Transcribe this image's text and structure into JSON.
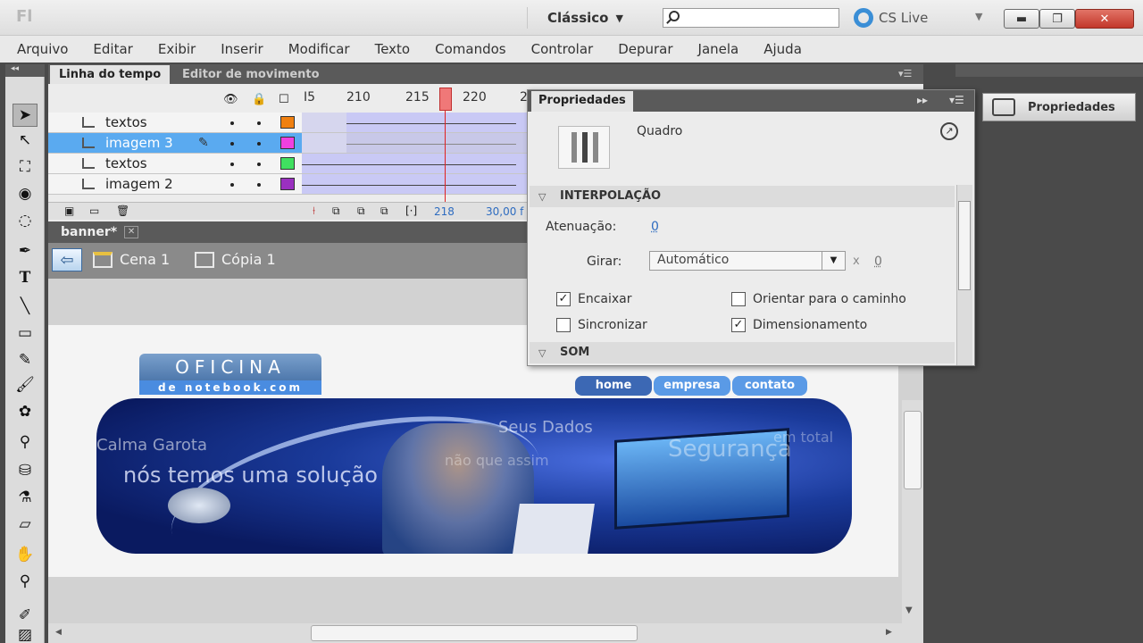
{
  "app": {
    "logo": "Fl"
  },
  "titlebar": {
    "workspace": "Clássico",
    "search_placeholder": "",
    "cslive": "CS Live"
  },
  "menu": [
    "Arquivo",
    "Editar",
    "Exibir",
    "Inserir",
    "Modificar",
    "Texto",
    "Comandos",
    "Controlar",
    "Depurar",
    "Janela",
    "Ajuda"
  ],
  "timeline": {
    "tabs": [
      "Linha do tempo",
      "Editor de movimento"
    ],
    "ruler": [
      "I5",
      "210",
      "215",
      "220",
      "2"
    ],
    "layers": [
      {
        "name": "textos",
        "color": "#f08010"
      },
      {
        "name": "imagem 3",
        "color": "#f040e0"
      },
      {
        "name": "textos",
        "color": "#40e060"
      },
      {
        "name": "imagem 2",
        "color": "#9a30c0"
      }
    ],
    "current_frame": "218",
    "fps": "30,00 f"
  },
  "document": {
    "tab": "banner*",
    "scene": "Cena 1",
    "symbol": "Cópia 1"
  },
  "banner": {
    "logo_top": "OFICINA",
    "logo_bottom": "de notebook.com",
    "nav": [
      "home",
      "empresa",
      "contato"
    ],
    "texts": [
      "Calma Garota",
      "nós temos uma solução",
      "Seus Dados",
      "não que assim",
      "Segurança",
      "em total"
    ]
  },
  "properties": {
    "title": "Propriedades",
    "type": "Quadro",
    "section_interp": "INTERPOLAÇÃO",
    "atten_label": "Atenuação:",
    "atten_value": "0",
    "girar_label": "Girar:",
    "girar_value": "Automático",
    "girar_x": "x",
    "girar_count": "0",
    "chk_encaixar": "Encaixar",
    "chk_sincronizar": "Sincronizar",
    "chk_orientar": "Orientar para o caminho",
    "chk_dimens": "Dimensionamento",
    "section_som": "SOM"
  },
  "right_panel": {
    "button": "Propriedades"
  }
}
